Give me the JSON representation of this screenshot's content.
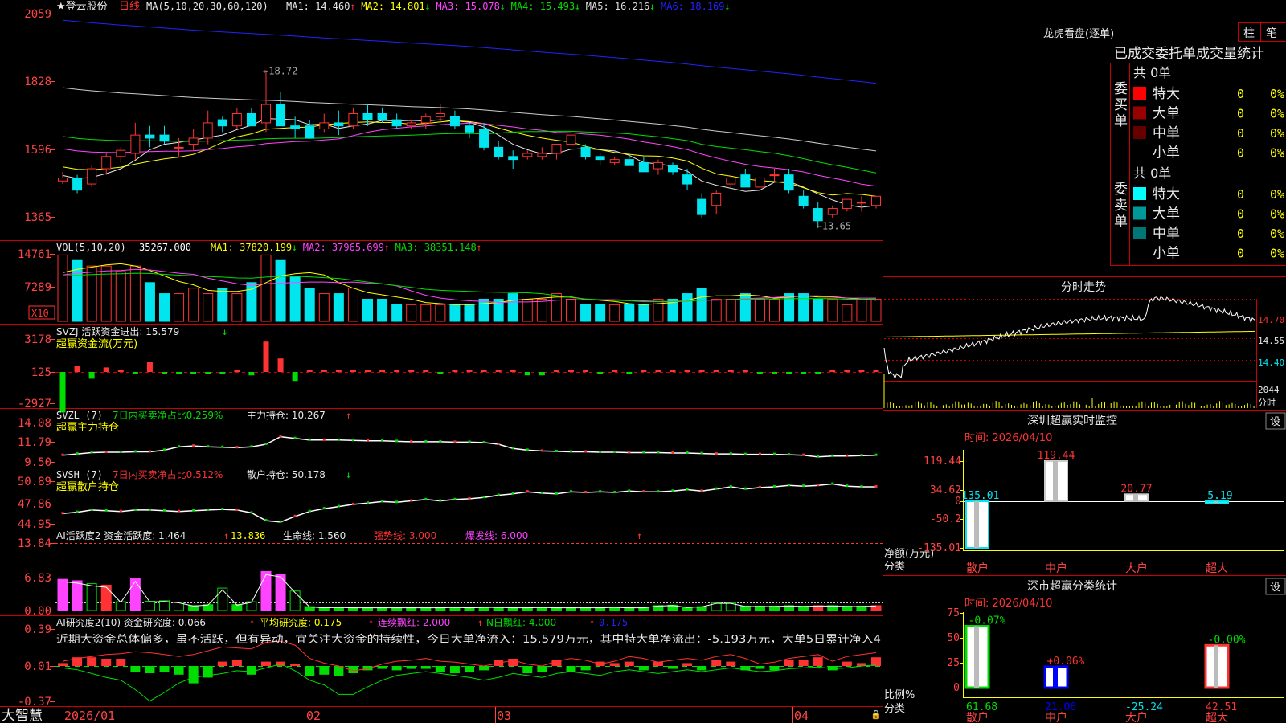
{
  "colors": {
    "up": "#ff3333",
    "down": "#00e5ee",
    "green": "#00dd00",
    "yellow": "#ffff00",
    "magenta": "#ff44ff",
    "white": "#e8e8e8",
    "axis_text": "#ff4444",
    "grid": "#cc0000"
  },
  "main": {
    "title": "★登云股份",
    "period": "日线",
    "ma_params": "MA(5,10,20,30,60,120)",
    "ma": [
      {
        "label": "MA1: 14.460",
        "arrow": "↑",
        "color": "#e8e8e8"
      },
      {
        "label": "MA2: 14.801",
        "arrow": "↓",
        "color": "#ffff00"
      },
      {
        "label": "MA3: 15.078",
        "arrow": "↓",
        "color": "#ff44ff"
      },
      {
        "label": "MA4: 15.493",
        "arrow": "↓",
        "color": "#00dd00"
      },
      {
        "label": "MA5: 16.216",
        "arrow": "↓",
        "color": "#dddddd"
      },
      {
        "label": "MA6: 18.169",
        "arrow": "↓",
        "color": "#2222ff"
      }
    ],
    "y_ticks": [
      "2059",
      "1828",
      "1596",
      "1365"
    ],
    "high_label": "18.72",
    "low_label": "13.65"
  },
  "vol": {
    "header": "VOL(5,10,20)",
    "value": "35267.000",
    "ma": [
      {
        "label": "MA1: 37820.199",
        "arrow": "↓",
        "color": "#ffff00"
      },
      {
        "label": "MA2: 37965.699",
        "arrow": "↑",
        "color": "#ff44ff"
      },
      {
        "label": "MA3: 38351.148",
        "arrow": "↑",
        "color": "#00dd00"
      }
    ],
    "y_ticks": [
      "14761",
      "7289"
    ],
    "unit": "X10"
  },
  "svzj": {
    "line1": "SVZJ  活跃资金进出: 15.579",
    "arrow": "↓",
    "line2": "超赢资金流(万元)",
    "y_ticks": [
      "3178",
      "125",
      "-2927"
    ]
  },
  "svzl": {
    "prefix": "SVZL (7)",
    "stat": "7日内买卖净占比0.259%",
    "main_label": "主力持仓: 10.267",
    "arrow": "↑",
    "line2": "超赢主力持仓",
    "y_ticks": [
      "14.08",
      "11.79",
      "9.50"
    ]
  },
  "svsh": {
    "prefix": "SVSH (7)",
    "stat": "7日内买卖净占比0.512%",
    "main_label": "散户持仓: 50.178",
    "arrow": "↓",
    "line2": "超赢散户持仓",
    "y_ticks": [
      "50.89",
      "47.86",
      "44.95"
    ]
  },
  "ai1": {
    "header": "AI活跃度2 资金活跃度: 1.464",
    "v2": "13.836",
    "life": "生命线: 1.560",
    "strong": "强势线: 3.000",
    "burst": "爆发线: 6.000",
    "y_ticks": [
      "13.84",
      "6.83",
      "0.00"
    ]
  },
  "ai2": {
    "header": "AI研究度2(10) 资金研究度: 0.066",
    "avg": "平均研究度: 0.175",
    "consec": "连续飘红: 2.000",
    "nday": "N日飘红: 4.000",
    "last": "0.175",
    "comment": "近期大资金总体偏多，虽不活跃，但有异动，宜关注大资金的持续性，今日大单净流入：15.579万元，其中特大单净流出：-5.193万元，大单5日累计净入4",
    "y_ticks": [
      "0.39",
      "0.01",
      "-0.37"
    ]
  },
  "x_axis": {
    "brand": "大智慧",
    "labels": [
      "2026/01",
      "02",
      "03",
      "04"
    ]
  },
  "right": {
    "lhb_title": "龙虎看盘(逐单)",
    "btn1": "柱",
    "btn2": "笔",
    "stats_title": "已成交委托单成交量统计",
    "buy": {
      "side": "委买单",
      "total": "共 0单",
      "rows": [
        {
          "name": "特大",
          "count": "0",
          "pct": "0%",
          "color": "#ff0000"
        },
        {
          "name": "大单",
          "count": "0",
          "pct": "0%",
          "color": "#990000"
        },
        {
          "name": "中单",
          "count": "0",
          "pct": "0%",
          "color": "#660000"
        },
        {
          "name": "小单",
          "count": "0",
          "pct": "0%",
          "color": "#000000"
        }
      ]
    },
    "sell": {
      "side": "委卖单",
      "total": "共 0单",
      "rows": [
        {
          "name": "特大",
          "count": "0",
          "pct": "0%",
          "color": "#00ffff"
        },
        {
          "name": "大单",
          "count": "0",
          "pct": "0%",
          "color": "#009999"
        },
        {
          "name": "中单",
          "count": "0",
          "pct": "0%",
          "color": "#007777"
        },
        {
          "name": "小单",
          "count": "0",
          "pct": "0%",
          "color": "#000000"
        }
      ]
    },
    "intraday": {
      "title": "分时走势",
      "y_ticks": [
        "14.70",
        "14.55",
        "14.40"
      ],
      "vol_label": "2044",
      "vol_unit": "分时"
    },
    "sz_monitor": {
      "title": "深圳超赢实时监控",
      "btn": "设",
      "time": "时间: 2026/04/10",
      "y_ticks": [
        "119.44",
        "34.62",
        "0",
        "-50.2",
        "-135.01"
      ],
      "ylabel": "净额(万元)",
      "xlabel": "分类",
      "categories": [
        "散户",
        "中户",
        "大户",
        "超大"
      ],
      "values": [
        -135.01,
        119.44,
        20.77,
        -5.19
      ],
      "value_labels": [
        "-135.01",
        "119.44",
        "20.77",
        "-5.19"
      ]
    },
    "sz_class": {
      "title": "深市超赢分类统计",
      "btn": "设",
      "time": "时间: 2026/04/10",
      "y_ticks": [
        "75",
        "50",
        "25",
        "0"
      ],
      "ylabel": "比例%",
      "xlabel": "分类",
      "categories": [
        "散户",
        "中户",
        "大户",
        "超大"
      ],
      "values": [
        61.68,
        21.06,
        -25.24,
        42.51
      ],
      "value_labels": [
        "61.68",
        "21.06",
        "-25.24",
        "42.51"
      ],
      "top_labels": [
        "-0.07%",
        "+0.06%",
        "",
        "-0.00%"
      ]
    }
  },
  "chart_data": [
    {
      "type": "candlestick",
      "title": "登云股份 日线",
      "x_labels": [
        "2026/01",
        "02",
        "03",
        "04"
      ],
      "y_range": [
        13.4,
        20.7
      ],
      "high": 18.72,
      "low": 13.65,
      "ohlc": [
        [
          15.1,
          15.4,
          15.0,
          15.2
        ],
        [
          15.2,
          15.3,
          14.7,
          14.8
        ],
        [
          15.0,
          15.6,
          14.9,
          15.5
        ],
        [
          15.5,
          16.0,
          15.3,
          15.9
        ],
        [
          15.9,
          16.2,
          15.7,
          16.1
        ],
        [
          16.0,
          17.0,
          15.8,
          16.6
        ],
        [
          16.6,
          16.9,
          16.2,
          16.5
        ],
        [
          16.6,
          16.9,
          16.3,
          16.4
        ],
        [
          16.2,
          16.5,
          15.9,
          16.2
        ],
        [
          16.3,
          16.8,
          16.1,
          16.5
        ],
        [
          16.5,
          17.4,
          16.3,
          17.0
        ],
        [
          17.1,
          17.2,
          16.7,
          16.9
        ],
        [
          16.9,
          17.5,
          16.8,
          17.3
        ],
        [
          17.3,
          17.5,
          16.9,
          16.9
        ],
        [
          17.0,
          18.72,
          16.7,
          17.6
        ],
        [
          17.6,
          18.0,
          17.0,
          16.9
        ],
        [
          16.9,
          17.2,
          16.5,
          16.8
        ],
        [
          16.9,
          17.1,
          16.5,
          16.5
        ],
        [
          16.8,
          17.3,
          16.7,
          17.0
        ],
        [
          17.0,
          17.4,
          16.6,
          16.9
        ],
        [
          16.9,
          17.5,
          16.8,
          17.3
        ],
        [
          17.3,
          17.6,
          16.9,
          17.1
        ],
        [
          17.3,
          17.5,
          17.0,
          17.1
        ],
        [
          17.1,
          17.3,
          16.8,
          16.9
        ],
        [
          16.9,
          17.1,
          16.8,
          17.0
        ],
        [
          17.0,
          17.3,
          16.8,
          17.2
        ],
        [
          17.2,
          17.6,
          17.0,
          17.3
        ],
        [
          17.2,
          17.4,
          16.8,
          16.9
        ],
        [
          16.9,
          17.0,
          16.5,
          16.7
        ],
        [
          16.8,
          17.0,
          16.1,
          16.2
        ],
        [
          16.2,
          16.4,
          15.8,
          15.9
        ],
        [
          15.9,
          16.1,
          15.5,
          15.8
        ],
        [
          15.9,
          16.1,
          15.8,
          16.0
        ],
        [
          15.9,
          16.2,
          15.8,
          16.0
        ],
        [
          16.0,
          16.3,
          15.8,
          16.3
        ],
        [
          16.3,
          16.6,
          16.2,
          16.6
        ],
        [
          16.2,
          16.3,
          15.8,
          15.9
        ],
        [
          15.9,
          16.0,
          15.6,
          15.8
        ],
        [
          15.7,
          15.9,
          15.6,
          15.8
        ],
        [
          15.8,
          16.0,
          15.6,
          15.6
        ],
        [
          15.7,
          15.9,
          15.4,
          15.4
        ],
        [
          15.5,
          15.8,
          15.3,
          15.7
        ],
        [
          15.6,
          15.7,
          15.3,
          15.4
        ],
        [
          15.3,
          15.5,
          14.8,
          15.0
        ],
        [
          14.5,
          14.7,
          13.9,
          14.0
        ],
        [
          14.3,
          14.8,
          14.0,
          14.7
        ],
        [
          15.0,
          15.3,
          14.9,
          15.2
        ],
        [
          15.3,
          15.5,
          14.9,
          14.9
        ],
        [
          14.9,
          15.2,
          14.7,
          15.2
        ],
        [
          15.3,
          15.5,
          15.1,
          15.3
        ],
        [
          15.3,
          15.5,
          14.7,
          14.8
        ],
        [
          14.6,
          14.8,
          14.2,
          14.3
        ],
        [
          14.2,
          14.4,
          13.65,
          13.8
        ],
        [
          14.0,
          14.3,
          13.9,
          14.2
        ],
        [
          14.2,
          14.5,
          14.1,
          14.5
        ],
        [
          14.4,
          14.6,
          14.1,
          14.4
        ],
        [
          14.3,
          14.6,
          14.2,
          14.6
        ]
      ]
    },
    {
      "type": "bar",
      "title": "VOL(5,10,20)",
      "y_ticks": [
        14761,
        7289
      ]
    },
    {
      "type": "bar",
      "title": "深圳超赢实时监控",
      "categories": [
        "散户",
        "中户",
        "大户",
        "超大"
      ],
      "values": [
        -135.01,
        119.44,
        20.77,
        -5.19
      ],
      "ylim": [
        -135.01,
        119.44
      ]
    },
    {
      "type": "bar",
      "title": "深市超赢分类统计",
      "categories": [
        "散户",
        "中户",
        "大户",
        "超大"
      ],
      "values": [
        61.68,
        21.06,
        -25.24,
        42.51
      ],
      "ylim": [
        0,
        75
      ]
    }
  ]
}
